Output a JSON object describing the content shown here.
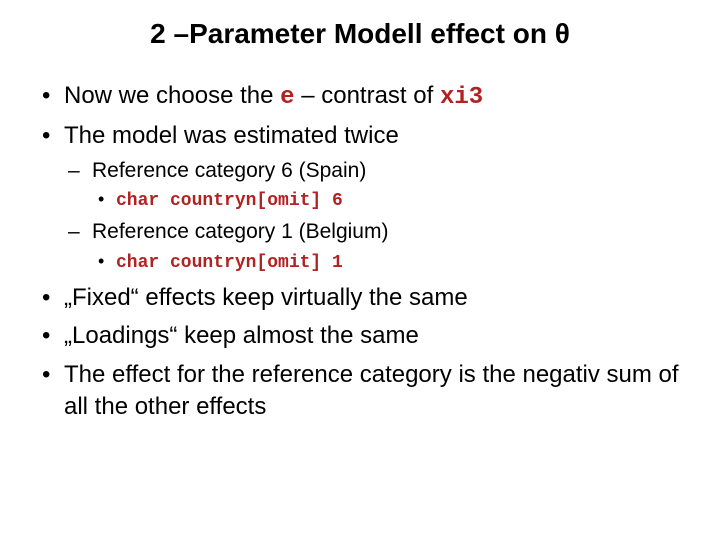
{
  "title": "2 –Parameter Modell effect on θ",
  "bullets": {
    "b1": {
      "pre": "Now we choose the ",
      "code1": "e",
      "mid": " – contrast of ",
      "code2": "xi3"
    },
    "b2": "The model was estimated twice",
    "b2_1": "Reference category 6 (Spain)",
    "b2_1_1": "char countryn[omit] 6",
    "b2_2": "Reference category 1 (Belgium)",
    "b2_2_1": "char countryn[omit] 1",
    "b3": "„Fixed“ effects keep virtually the same",
    "b4": "„Loadings“ keep almost the same",
    "b5": "The effect for the reference category is the negativ sum of all the other effects"
  }
}
